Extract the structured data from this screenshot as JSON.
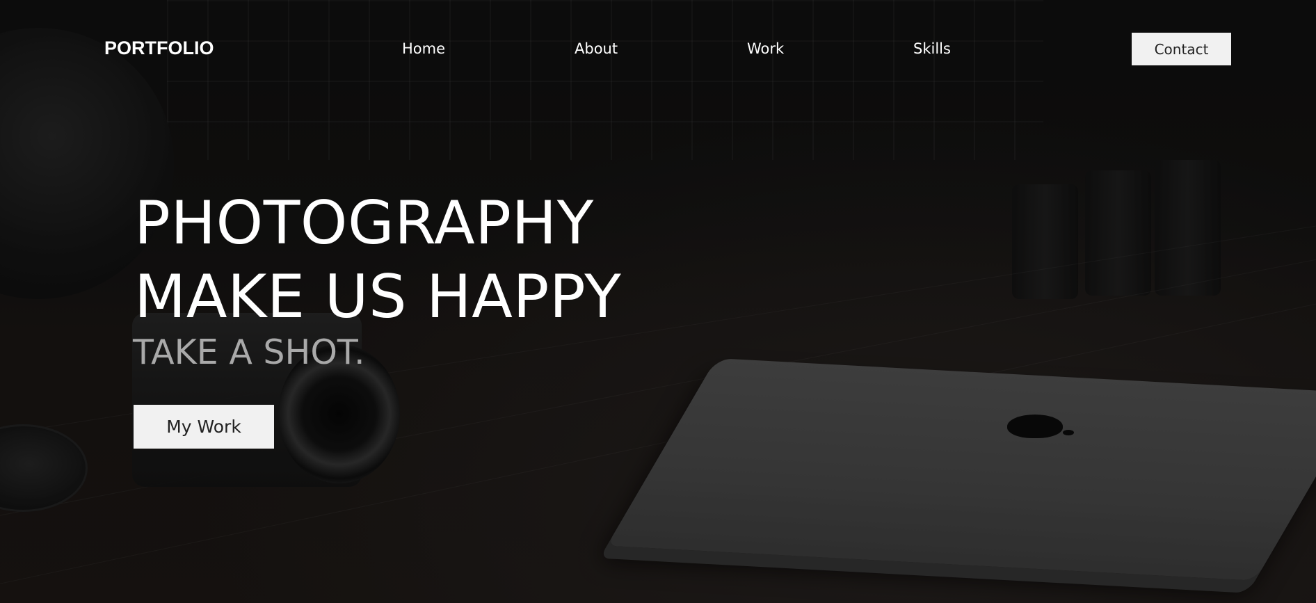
{
  "navbar": {
    "logo": "PORTFOLIO",
    "links": [
      {
        "label": "Home"
      },
      {
        "label": "About"
      },
      {
        "label": "Work"
      },
      {
        "label": "Skills"
      }
    ],
    "contact_label": "Contact"
  },
  "hero": {
    "title_line1": "PHOTOGRAPHY",
    "title_line2": "MAKE US HAPPY",
    "tagline": "TAKE A SHOT.",
    "cta_label": "My Work"
  },
  "colors": {
    "text": "#ffffff",
    "tagline": "#a9a9a9",
    "button_bg": "#f1f1f1",
    "button_text": "#222222",
    "background": "#121212"
  }
}
